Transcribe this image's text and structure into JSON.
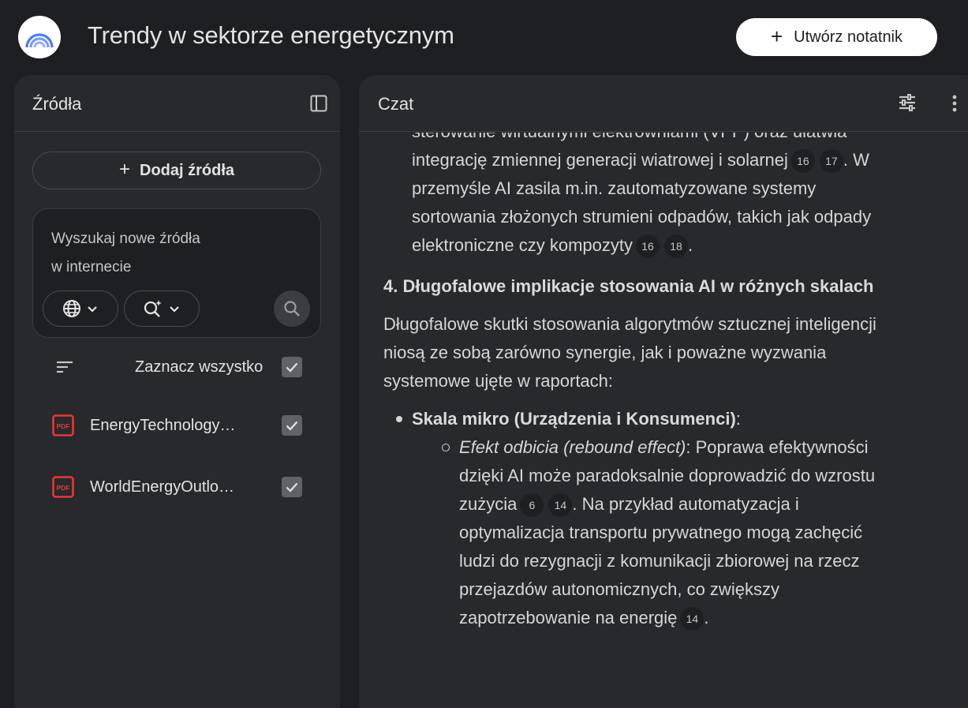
{
  "header": {
    "title": "Trendy w sektorze energetycznym",
    "create_button": "Utwórz notatnik"
  },
  "sources_panel": {
    "title": "Źródła",
    "add_button": "Dodaj źródła",
    "search_placeholder_line1": "Wyszukaj nowe źródła",
    "search_placeholder_line2": "w internecie",
    "select_all_label": "Zaznacz wszystko",
    "items": [
      {
        "name": "EnergyTechnology…",
        "type": "PDF",
        "checked": true
      },
      {
        "name": "WorldEnergyOutlo…",
        "type": "PDF",
        "checked": true
      }
    ]
  },
  "chat_panel": {
    "title": "Czat",
    "content": {
      "p1_top": "sterowanie wirtualnymi elektrowniami (VPP) oraz ułatwia",
      "p1_a": "integrację zmiennej generacji wiatrowej i solarnej",
      "p1_cites_a": [
        "16",
        "17"
      ],
      "p1_b": "W przemyśle AI zasila m.in. zautomatyzowane systemy sortowania złożonych strumieni odpadów, takich jak odpady elektroniczne czy kompozyty",
      "p1_cites_b": [
        "16",
        "18"
      ],
      "heading": "4. Długofalowe implikacje stosowania AI w różnych skalach",
      "para": "Długofalowe skutki stosowania algorytmów sztucznej inteligencji niosą ze sobą zarówno synergie, jak i poważne wyzwania systemowe ujęte w raportach:",
      "bullet1_bold": "Skala mikro (Urządzenia i Konsumenci)",
      "sub1_italic": "Efekt odbicia (rebound effect)",
      "sub1_a": ": Poprawa efektywności dzięki AI może paradoksalnie doprowadzić do wzrostu zużycia",
      "sub1_cites_a": [
        "6",
        "14"
      ],
      "sub1_b": ". Na przykład automatyzacja i optymalizacja transportu prywatnego mogą zachęcić ludzi do rezygnacji z komunikacji zbiorowej na rzecz przejazdów autonomicznych, co zwiększy zapotrzebowanie na energię",
      "sub1_cites_b": [
        "14"
      ]
    }
  },
  "colors": {
    "background": "#1e1f22",
    "panel": "#28292c",
    "text": "#e3e3e3",
    "pdf_red": "#e53935"
  },
  "icons": {
    "logo": "notebook-logo-icon",
    "collapse": "panel-collapse-icon",
    "web": "globe-icon",
    "research": "search-sparkle-icon",
    "search": "search-icon",
    "sort": "sort-lines-icon",
    "check": "check-icon",
    "pdf": "pdf-icon",
    "tune": "tune-icon",
    "more": "more-vertical-icon"
  }
}
